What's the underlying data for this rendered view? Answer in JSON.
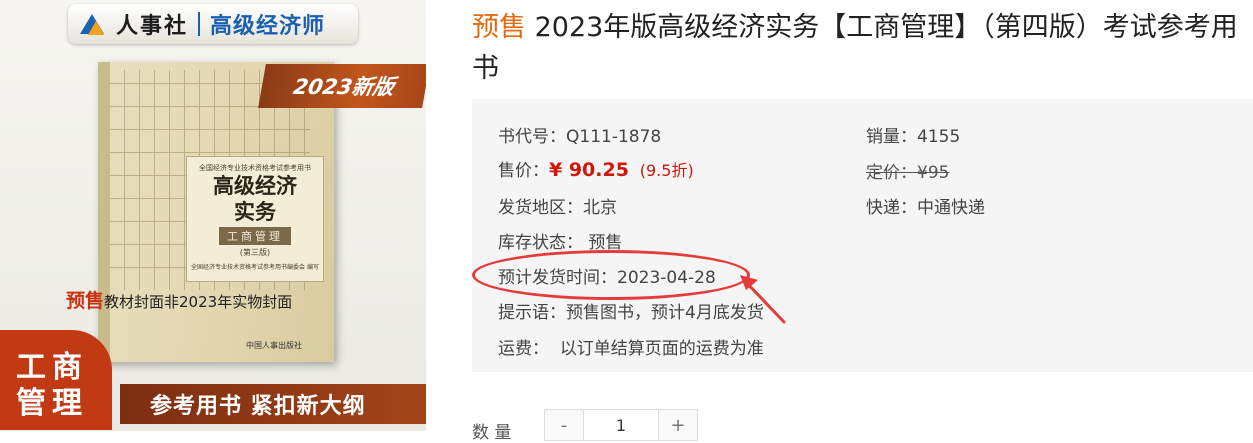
{
  "cover": {
    "brand_name": "人事社",
    "brand_title": "高级经济师",
    "edition_badge": "2023新版",
    "book_series": "全国经济专业技术资格考试参考用书",
    "book_title_line1": "高级经济",
    "book_title_line2": "实务",
    "book_subject": "工商管理",
    "book_edition": "(第三版)",
    "book_org": "全国经济专业技术资格考试参考用书编委会 编写",
    "publisher": "中国人事出版社",
    "note_presale": "预售",
    "note_text": "教材封面非2023年实物封面",
    "bottom_slogan": "参考用书 紧扣新大纲",
    "corner_badge": "工商管理"
  },
  "product": {
    "presale_tag": "预售",
    "title": " 2023年版高级经济实务【工商管理】（第四版）考试参考用书"
  },
  "info": {
    "code_label": "书代号：",
    "code_value": "Q111-1878",
    "sales_label": "销量：",
    "sales_value": "4155",
    "price_label": "售价：",
    "price_value": "¥ 90.25",
    "discount": "(9.5折)",
    "list_price_label": "定价：",
    "list_price_value": "¥95",
    "region_label": "发货地区：",
    "region_value": "北京",
    "courier_label": "快递：",
    "courier_value": "中通快递",
    "stock_label": "库存状态：",
    "stock_value": "预售",
    "ship_time_label": "预计发货时间：",
    "ship_time_value": "2023-04-28",
    "hint_label": "提示语：",
    "hint_value": "预售图书，预计4月底发货",
    "freight_label": "运费：",
    "freight_value": "以订单结算页面的运费为准"
  },
  "quantity": {
    "label": "数  量",
    "minus": "-",
    "value": "1",
    "plus": "+"
  },
  "colors": {
    "presale": "#e26b11",
    "price": "#d0160b",
    "annotation": "#e53b3b",
    "info_bg": "#f5f5f5"
  }
}
